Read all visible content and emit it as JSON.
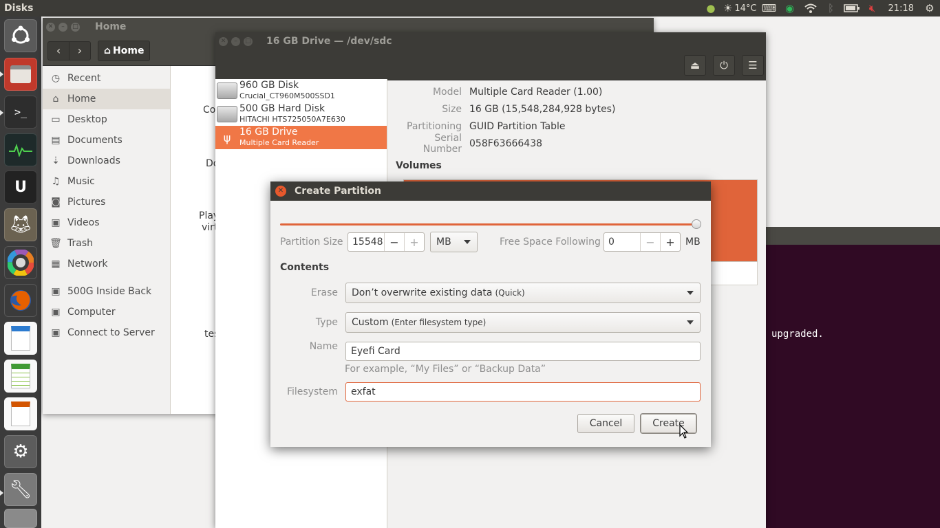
{
  "top_panel": {
    "app_title": "Disks",
    "weather_temp": "14°C",
    "clock": "21:18"
  },
  "launcher": {
    "items": [
      "dash-home",
      "files",
      "terminal",
      "system-monitor",
      "unreal-engine",
      "gimp",
      "color-picker",
      "firefox",
      "libreoffice-writer",
      "libreoffice-calc",
      "libreoffice-impress",
      "system-settings",
      "disks",
      "removable-drive"
    ]
  },
  "nautilus": {
    "title": "Home",
    "path_button": "Home",
    "sidebar": [
      {
        "label": "Recent",
        "icon": "clock-icon"
      },
      {
        "label": "Home",
        "icon": "home-icon"
      },
      {
        "label": "Desktop",
        "icon": "folder-icon"
      },
      {
        "label": "Documents",
        "icon": "document-icon"
      },
      {
        "label": "Downloads",
        "icon": "download-icon"
      },
      {
        "label": "Music",
        "icon": "music-icon"
      },
      {
        "label": "Pictures",
        "icon": "camera-icon"
      },
      {
        "label": "Videos",
        "icon": "video-icon"
      },
      {
        "label": "Trash",
        "icon": "trash-icon"
      },
      {
        "label": "Network",
        "icon": "network-icon"
      },
      {
        "label": "500G Inside Back",
        "icon": "drive-icon"
      },
      {
        "label": "Computer",
        "icon": "drive-icon"
      },
      {
        "label": "Connect to Server",
        "icon": "server-icon"
      }
    ],
    "file_fragments": [
      "Co",
      "Do",
      "Play",
      "virt",
      "tes"
    ]
  },
  "terminal": {
    "text": "upgraded."
  },
  "disks": {
    "title": "16 GB Drive — /dev/sdc",
    "devices": [
      {
        "name": "960 GB Disk",
        "sub": "Crucial_CT960M500SSD1"
      },
      {
        "name": "500 GB Hard Disk",
        "sub": "HITACHI HTS725050A7E630"
      },
      {
        "name": "16 GB Drive",
        "sub": "Multiple Card  Reader"
      }
    ],
    "info": [
      {
        "key": "Model",
        "value": "Multiple Card  Reader (1.00)"
      },
      {
        "key": "Size",
        "value": "16 GB (15,548,284,928 bytes)"
      },
      {
        "key": "Partitioning",
        "value": "GUID Partition Table"
      },
      {
        "key": "Serial Number",
        "value": "058F63666438"
      }
    ],
    "volumes_label": "Volumes"
  },
  "dialog": {
    "title": "Create Partition",
    "size_fraction": 1.0,
    "partition_size_label": "Partition Size",
    "partition_size_value": "15548",
    "unit_value": "MB",
    "free_space_label": "Free Space Following",
    "free_space_value": "0",
    "free_space_unit": "MB",
    "contents_label": "Contents",
    "erase_label": "Erase",
    "erase_value": "Don’t overwrite existing data",
    "erase_hint": "(Quick)",
    "type_label": "Type",
    "type_value": "Custom",
    "type_hint": "(Enter filesystem type)",
    "name_label": "Name",
    "name_value": "Eyefi Card",
    "name_example": "For example, “My Files” or “Backup Data”",
    "filesystem_label": "Filesystem",
    "filesystem_value": "exfat",
    "cancel_label": "Cancel",
    "create_label": "Create"
  }
}
